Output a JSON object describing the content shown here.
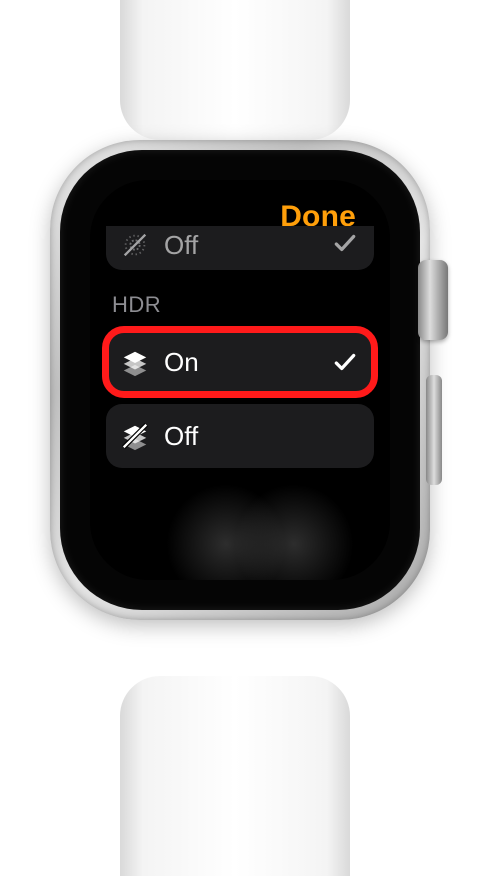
{
  "header": {
    "done_label": "Done"
  },
  "prev": {
    "off_label": "Off"
  },
  "hdr": {
    "section_title": "HDR",
    "on_label": "On",
    "off_label": "Off"
  }
}
